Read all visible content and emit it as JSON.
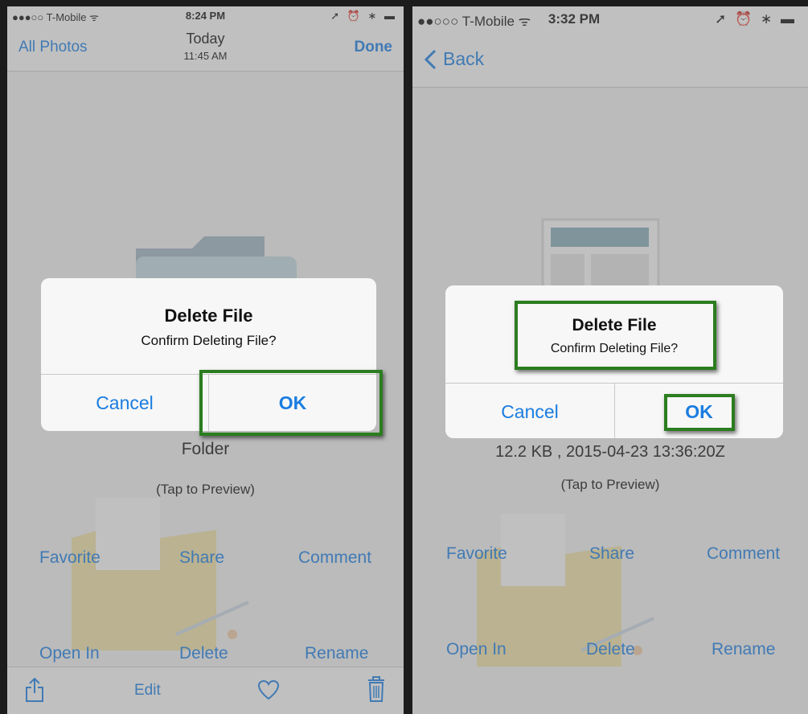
{
  "left": {
    "status": {
      "carrier": "●●●○○ T-Mobile ᯤ",
      "time": "8:24 PM",
      "indicators": "➚ ⏰ ∗ ▬"
    },
    "nav": {
      "back_label": "All Photos",
      "title": "Today",
      "subtitle": "11:45 AM",
      "done_label": "Done"
    },
    "file_name": "Folder",
    "hint": "(Tap to Preview)",
    "actions": [
      "Favorite",
      "Share",
      "Comment",
      "Open In",
      "Delete",
      "Rename"
    ],
    "alert": {
      "title": "Delete File",
      "message": "Confirm Deleting File?",
      "cancel": "Cancel",
      "ok": "OK"
    },
    "toolbar": {
      "edit_label": "Edit",
      "share_icon": "share-icon",
      "heart_icon": "heart-icon",
      "trash_icon": "trash-icon"
    }
  },
  "right": {
    "status": {
      "carrier": "●●○○○ T-Mobile ᯤ",
      "time": "3:32 PM",
      "indicators": "➚ ⏰ ∗ ▬"
    },
    "nav": {
      "back_label": "Back"
    },
    "file_info": "12.2 KB , 2015-04-23 13:36:20Z",
    "hint": "(Tap to Preview)",
    "actions": [
      "Favorite",
      "Share",
      "Comment",
      "Open In",
      "Delete",
      "Rename"
    ],
    "alert": {
      "title": "Delete File",
      "message": "Confirm Deleting File?",
      "cancel": "Cancel",
      "ok": "OK"
    }
  },
  "colors": {
    "accent": "#1a7de0",
    "highlight": "#2b7d1f",
    "folder": "#e9c94f",
    "dialog_bg": "#f7f7f7"
  }
}
